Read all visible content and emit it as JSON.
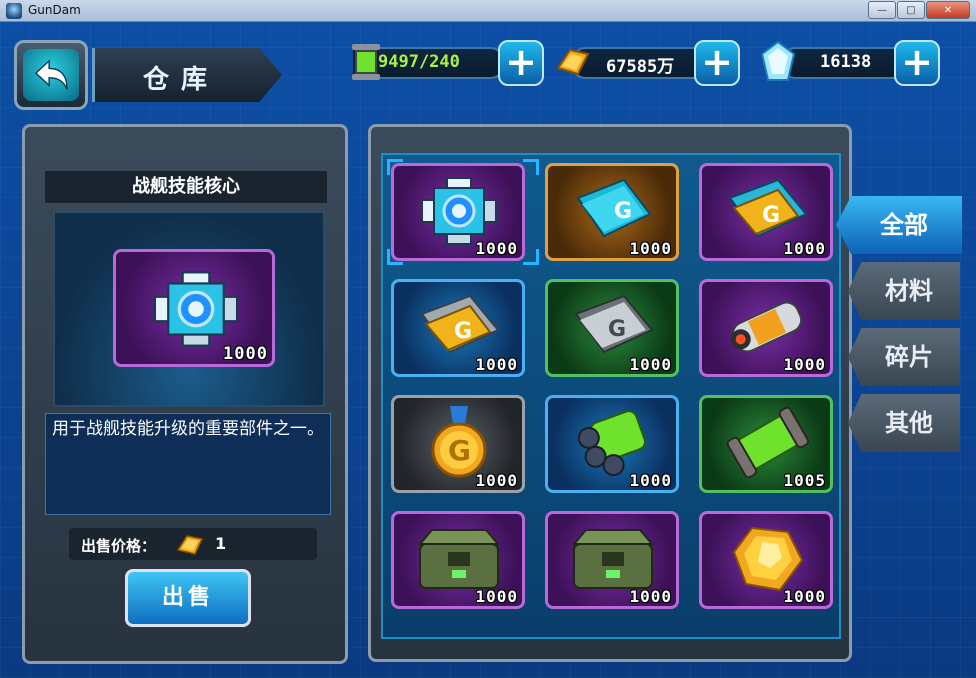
{
  "window": {
    "title": "GunDam",
    "minimize": "—",
    "maximize": "□",
    "close": "✕"
  },
  "header": {
    "title": "仓库"
  },
  "resources": {
    "energy": {
      "value": "9497/240",
      "icon": "energy-canister-icon"
    },
    "gold": {
      "value": "67585万",
      "icon": "gold-bar-icon"
    },
    "crystal": {
      "value": "16138",
      "icon": "crystal-icon"
    },
    "plus": "+"
  },
  "detail": {
    "name": "战舰技能核心",
    "count": "1000",
    "description": "用于战舰技能升级的重要部件之一。",
    "price_label": "出售价格：",
    "price_value": "1",
    "sell_label": "出售"
  },
  "tabs": [
    "全部",
    "材料",
    "碎片",
    "其他"
  ],
  "items": [
    {
      "name": "战舰技能核心",
      "count": "1000",
      "quality": "purple",
      "icon": "skill-core-icon"
    },
    {
      "name": "蓝色芯片书",
      "count": "1000",
      "quality": "orange",
      "icon": "cyan-chip-icon"
    },
    {
      "name": "金色芯片",
      "count": "1000",
      "quality": "purple",
      "icon": "gold-chip-icon"
    },
    {
      "name": "金色芯片",
      "count": "1000",
      "quality": "blue",
      "icon": "gold-chip-icon"
    },
    {
      "name": "银色芯片",
      "count": "1000",
      "quality": "green",
      "icon": "silver-chip-icon"
    },
    {
      "name": "能量电池",
      "count": "1000",
      "quality": "purple",
      "icon": "battery-icon"
    },
    {
      "name": "G币勋章",
      "count": "1000",
      "quality": "grey",
      "icon": "g-medal-icon"
    },
    {
      "name": "推进器",
      "count": "1000",
      "quality": "blue",
      "icon": "thruster-icon"
    },
    {
      "name": "绿色能量罐",
      "count": "1005",
      "quality": "green",
      "icon": "green-canister-icon"
    },
    {
      "name": "补给箱",
      "count": "1000",
      "quality": "purple",
      "icon": "supply-crate-icon"
    },
    {
      "name": "补给箱",
      "count": "1000",
      "quality": "purple",
      "icon": "supply-crate-icon"
    },
    {
      "name": "金色晶石",
      "count": "1000",
      "quality": "purple",
      "icon": "gold-crystal-icon"
    }
  ]
}
